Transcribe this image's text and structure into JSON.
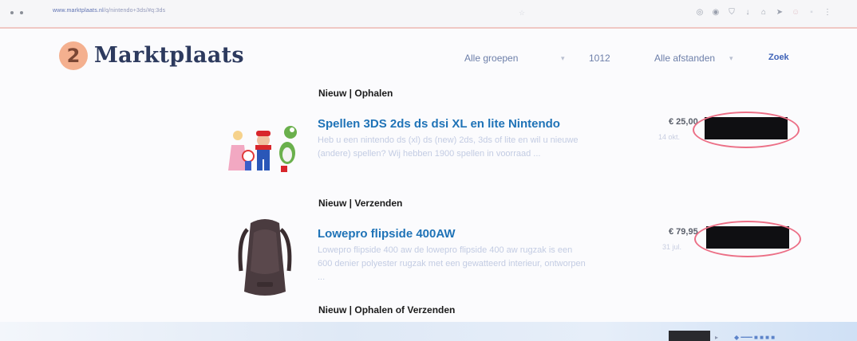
{
  "browser": {
    "url_host": "www.marktplaats.nl",
    "url_path": "/q/nintendo+3ds/#q:3ds",
    "toolbar_icons": [
      "circle-icon",
      "record-icon",
      "shield-icon",
      "download-icon",
      "home-icon",
      "send-icon",
      "emoji-icon",
      "menu-icon"
    ]
  },
  "header": {
    "logo_mark": "2",
    "logo_text": "Marktplaats",
    "group_select": "Alle groepen",
    "postcode": "1012",
    "distance_select": "Alle afstanden",
    "search_button": "Zoek"
  },
  "listings": [
    {
      "tag": "Nieuw | Ophalen",
      "title": "Spellen 3DS 2ds ds dsi XL en lite Nintendo",
      "description": "Heb u een nintendo ds (xl) ds (new) 2ds, 3ds of lite en wil u nieuwe (andere) spellen? Wij hebben 1900 spellen in voorraad ...",
      "price": "€ 25,00",
      "meta": "14 okt."
    },
    {
      "tag": "Nieuw | Verzenden",
      "title": "Lowepro flipside 400AW",
      "description": "Lowepro flipside 400 aw de lowepro flipside 400 aw rugzak is een 600 denier polyester rugzak met een gewatteerd interieur, ontworpen ...",
      "price": "€ 79,95",
      "meta": "31 jul."
    },
    {
      "tag": "Nieuw | Ophalen of Verzenden"
    }
  ],
  "colors": {
    "brand_navy": "#2d3a5e",
    "brand_orange": "#f4b08f",
    "link_blue": "#1f73b7",
    "annotation_red": "#ec6f86"
  }
}
